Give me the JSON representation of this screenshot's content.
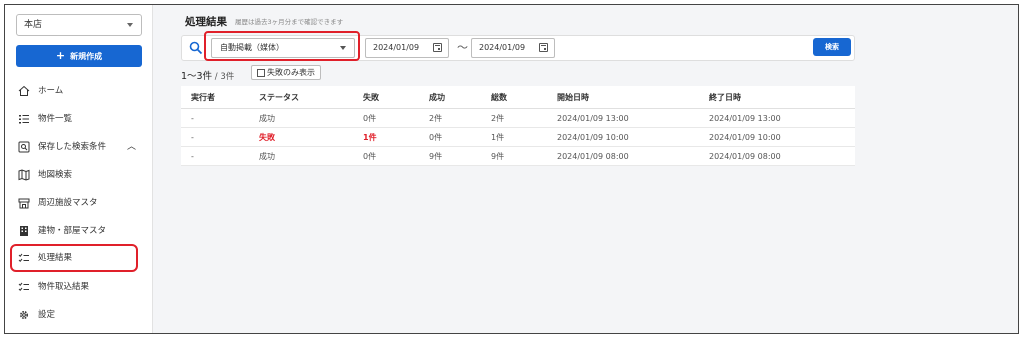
{
  "sidebar": {
    "store_select": "本店",
    "new_button": "新規作成",
    "items": [
      {
        "label": "ホーム",
        "icon": "home-icon"
      },
      {
        "label": "物件一覧",
        "icon": "list-icon"
      },
      {
        "label": "保存した検索条件",
        "icon": "saved-search-icon",
        "expanded": true
      },
      {
        "label": "地図検索",
        "icon": "map-icon"
      },
      {
        "label": "周辺施設マスタ",
        "icon": "facility-icon"
      },
      {
        "label": "建物・部屋マスタ",
        "icon": "building-icon"
      },
      {
        "label": "処理結果",
        "icon": "checklist-icon",
        "highlighted": true
      },
      {
        "label": "物件取込結果",
        "icon": "checklist-icon"
      },
      {
        "label": "設定",
        "icon": "gear-icon"
      }
    ]
  },
  "main": {
    "title": "処理結果",
    "subtitle": "履歴は過去3ヶ月分まで確認できます",
    "search": {
      "media_select": "自動掲載（媒体）",
      "date_from": "2024/01/09",
      "date_sep": "〜",
      "date_to": "2024/01/09",
      "button": "検索"
    },
    "count": "1〜3件",
    "count_total": " / 3件",
    "fail_only_toggle": "失敗のみ表示",
    "table": {
      "headers": [
        "実行者",
        "ステータス",
        "失敗",
        "成功",
        "総数",
        "開始日時",
        "終了日時"
      ],
      "rows": [
        [
          "-",
          "成功",
          "0件",
          "2件",
          "2件",
          "2024/01/09 13:00",
          "2024/01/09 13:00"
        ],
        [
          "-",
          "失敗",
          "1件",
          "0件",
          "1件",
          "2024/01/09 10:00",
          "2024/01/09 10:00"
        ],
        [
          "-",
          "成功",
          "0件",
          "9件",
          "9件",
          "2024/01/09 08:00",
          "2024/01/09 08:00"
        ]
      ]
    }
  },
  "colors": {
    "primary": "#1767d2",
    "error": "#e0202a",
    "highlight_box": "#e0202a"
  }
}
